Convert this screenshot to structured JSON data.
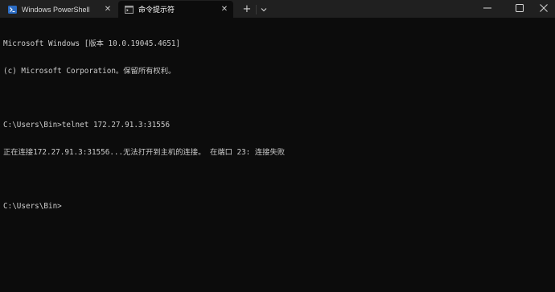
{
  "tabs": [
    {
      "title": "Windows PowerShell",
      "icon": "powershell-icon",
      "active": false
    },
    {
      "title": "命令提示符",
      "icon": "cmd-icon",
      "active": true
    }
  ],
  "tab_actions": {
    "new_tab": "+",
    "dropdown": "⌄"
  },
  "window_controls": {
    "minimize": "—",
    "maximize": "□",
    "close": "✕"
  },
  "terminal": {
    "lines": [
      "Microsoft Windows [版本 10.0.19045.4651]",
      "(c) Microsoft Corporation。保留所有权利。",
      "",
      "C:\\Users\\Bin>telnet 172.27.91.3:31556",
      "正在连接172.27.91.3:31556...无法打开到主机的连接。 在端口 23: 连接失败",
      "",
      "C:\\Users\\Bin>"
    ]
  },
  "colors": {
    "background": "#0c0c0c",
    "tabbar": "#202020",
    "text": "#cccccc"
  }
}
